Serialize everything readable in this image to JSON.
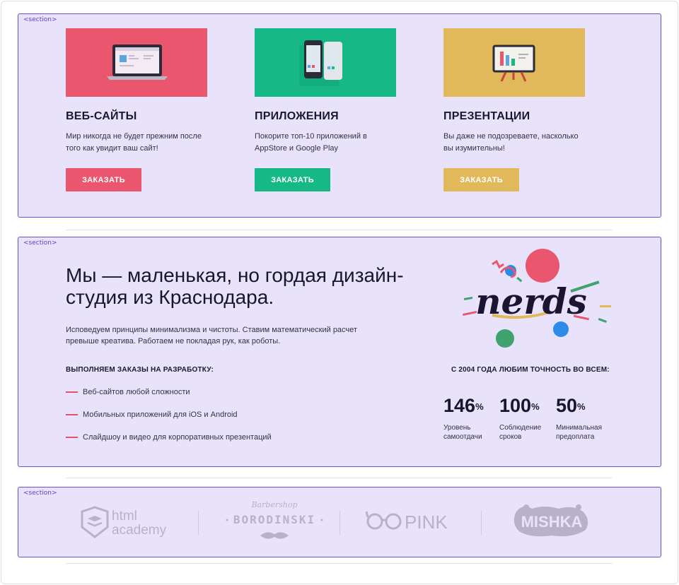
{
  "section_tag": "<section>",
  "services": [
    {
      "title": "ВЕБ-САЙТЫ",
      "text": "Мир никогда не будет прежним после того как увидит ваш сайт!",
      "button": "ЗАКАЗАТЬ",
      "color": "#e9566e"
    },
    {
      "title": "ПРИЛОЖЕНИЯ",
      "text": "Покорите топ-10 приложений в AppStore и Google Play",
      "button": "ЗАКАЗАТЬ",
      "color": "#16b986"
    },
    {
      "title": "ПРЕЗЕНТАЦИИ",
      "text": "Вы даже не подозреваете, насколько вы изумительны!",
      "button": "ЗАКАЗАТЬ",
      "color": "#e2b95a"
    }
  ],
  "about": {
    "headline": "Мы — маленькая, но гордая дизайн-студия из Краснодара.",
    "intro": "Исповедуем принципы минимализма и чистоты. Ставим математический расчет превыше креатива. Работаем не покладая рук, как роботы.",
    "list_title": "ВЫПОЛНЯЕМ ЗАКАЗЫ НА РАЗРАБОТКУ:",
    "list": [
      "Веб-сайтов любой сложности",
      "Мобильных приложений для iOS и Android",
      "Слайдшоу и видео для корпоративных презентаций"
    ],
    "since": "С 2004 ГОДА ЛЮБИМ ТОЧНОСТЬ ВО ВСЕМ:",
    "stats": [
      {
        "value": "146",
        "unit": "%",
        "label": "Уровень самоотдачи"
      },
      {
        "value": "100",
        "unit": "%",
        "label": "Соблюдение сроков"
      },
      {
        "value": "50",
        "unit": "%",
        "label": "Минимальная предоплата"
      }
    ],
    "logo_text": "nerds"
  },
  "partners": {
    "htmlacademy": {
      "line1": "html",
      "line2": "academy"
    },
    "borodinski": {
      "small": "Barbershop",
      "main": "BORODINSKI"
    },
    "pink": {
      "text": "PINK"
    },
    "mishka": {
      "text": "MISHKA"
    }
  }
}
